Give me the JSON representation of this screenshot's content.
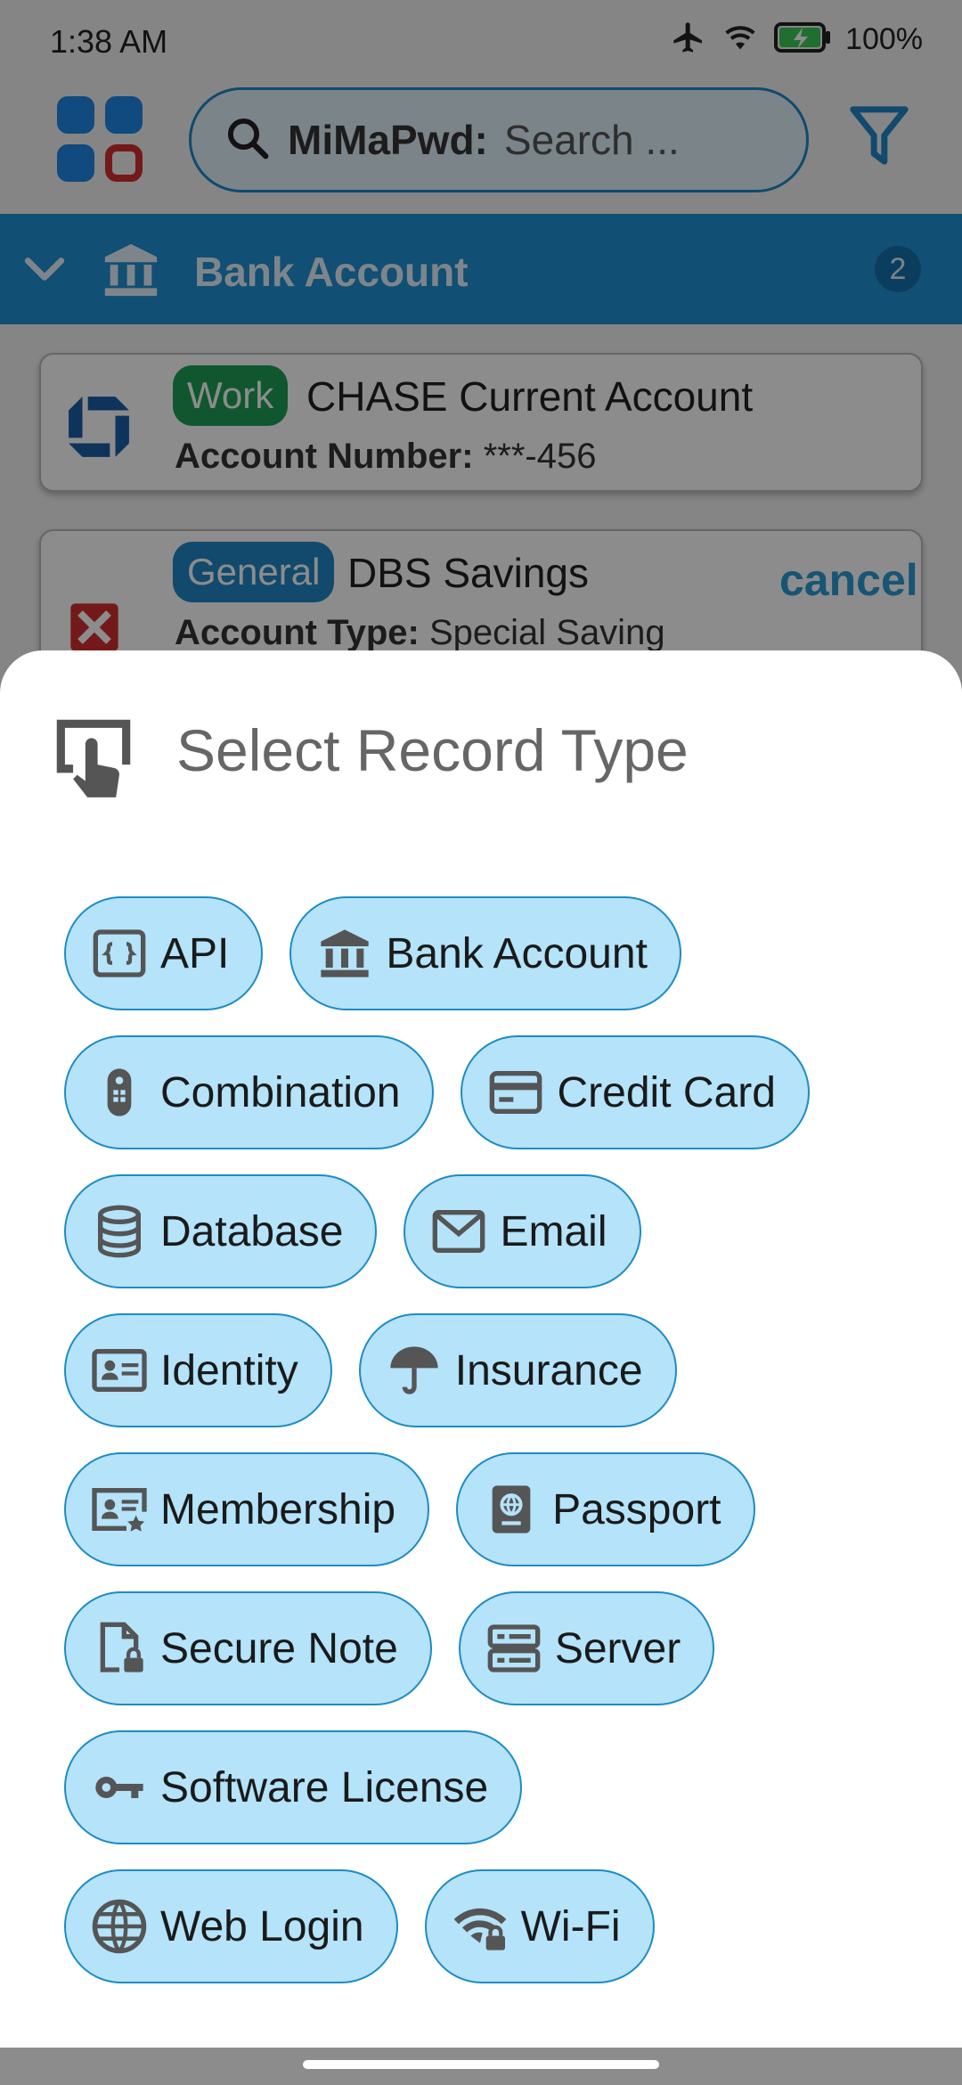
{
  "status_bar": {
    "time": "1:38 AM",
    "battery_pct": "100%"
  },
  "app_bar": {
    "app_name": "MiMaPwd:",
    "search_placeholder": "Search ..."
  },
  "group": {
    "title": "Bank Account",
    "count": "2"
  },
  "records": [
    {
      "tag": "Work",
      "tag_color": "#1e9e58",
      "title": "CHASE Current Account",
      "field_label": "Account Number:",
      "field_value": "***-456"
    },
    {
      "tag": "General",
      "tag_color": "#1f88c6",
      "title": "DBS Savings",
      "field_label": "Account Type:",
      "field_value": "Special Saving"
    }
  ],
  "swipe_action": {
    "cancel_label": "cancel"
  },
  "sheet": {
    "title": "Select Record Type",
    "types": [
      {
        "label": "API",
        "icon": "api-icon"
      },
      {
        "label": "Bank Account",
        "icon": "bank-icon"
      },
      {
        "label": "Combination",
        "icon": "remote-icon"
      },
      {
        "label": "Credit Card",
        "icon": "credit-card-icon"
      },
      {
        "label": "Database",
        "icon": "database-icon"
      },
      {
        "label": "Email",
        "icon": "envelope-icon"
      },
      {
        "label": "Identity",
        "icon": "id-card-icon"
      },
      {
        "label": "Insurance",
        "icon": "umbrella-icon"
      },
      {
        "label": "Membership",
        "icon": "membership-card-icon"
      },
      {
        "label": "Passport",
        "icon": "passport-icon"
      },
      {
        "label": "Secure Note",
        "icon": "locked-note-icon"
      },
      {
        "label": "Server",
        "icon": "server-icon"
      },
      {
        "label": "Software License",
        "icon": "key-icon"
      },
      {
        "label": "Web Login",
        "icon": "globe-icon"
      },
      {
        "label": "Wi-Fi",
        "icon": "wifi-lock-icon"
      }
    ]
  }
}
